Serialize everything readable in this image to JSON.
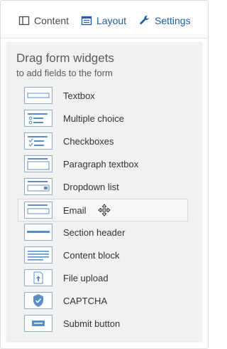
{
  "tabs": {
    "content": "Content",
    "layout": "Layout",
    "settings": "Settings"
  },
  "panel": {
    "heading": "Drag form widgets",
    "subheading": "to add fields to the form"
  },
  "widgets": [
    {
      "label": "Textbox",
      "icon": "textbox-icon"
    },
    {
      "label": "Multiple choice",
      "icon": "multiple-choice-icon"
    },
    {
      "label": "Checkboxes",
      "icon": "checkboxes-icon"
    },
    {
      "label": "Paragraph textbox",
      "icon": "paragraph-textbox-icon"
    },
    {
      "label": "Dropdown list",
      "icon": "dropdown-list-icon"
    },
    {
      "label": "Email",
      "icon": "email-icon"
    },
    {
      "label": "Section header",
      "icon": "section-header-icon"
    },
    {
      "label": "Content block",
      "icon": "content-block-icon"
    },
    {
      "label": "File upload",
      "icon": "file-upload-icon"
    },
    {
      "label": "CAPTCHA",
      "icon": "captcha-icon"
    },
    {
      "label": "Submit button",
      "icon": "submit-button-icon"
    }
  ],
  "colors": {
    "accent": "#1f5fa8",
    "icon_border": "#8aa9cb",
    "icon_fill": "#5b8ec8",
    "panel_bg": "#f1f1f1"
  }
}
